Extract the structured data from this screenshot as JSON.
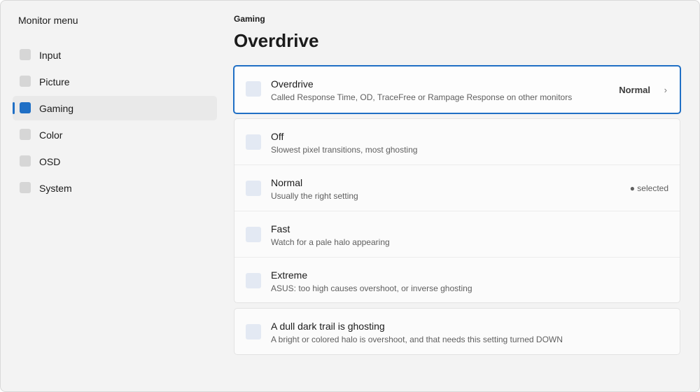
{
  "app": {
    "title": "Monitor menu"
  },
  "sidebar": {
    "items": [
      {
        "label": "Input",
        "active": false
      },
      {
        "label": "Picture",
        "active": false
      },
      {
        "label": "Gaming",
        "active": true
      },
      {
        "label": "Color",
        "active": false
      },
      {
        "label": "OSD",
        "active": false
      },
      {
        "label": "System",
        "active": false
      }
    ]
  },
  "main": {
    "breadcrumb": "Gaming",
    "title": "Overdrive",
    "setting": {
      "title": "Overdrive",
      "description": "Called Response Time, OD, TraceFree or Rampage Response on other monitors",
      "value": "Normal",
      "chevron": "›"
    },
    "options": [
      {
        "title": "Off",
        "description": "Slowest pixel transitions, most ghosting",
        "status": ""
      },
      {
        "title": "Normal",
        "description": "Usually the right setting",
        "status": "● selected"
      },
      {
        "title": "Fast",
        "description": "Watch for a pale halo appearing",
        "status": ""
      },
      {
        "title": "Extreme",
        "description": "ASUS: too high causes overshoot, or inverse ghosting",
        "status": ""
      }
    ],
    "tip": {
      "title": "A dull dark trail is ghosting",
      "description": "A bright or colored halo is overshoot, and that needs this setting turned DOWN"
    }
  },
  "colors": {
    "accent": "#1f6fc5",
    "background": "#f3f3f3",
    "card": "#fbfbfb"
  }
}
